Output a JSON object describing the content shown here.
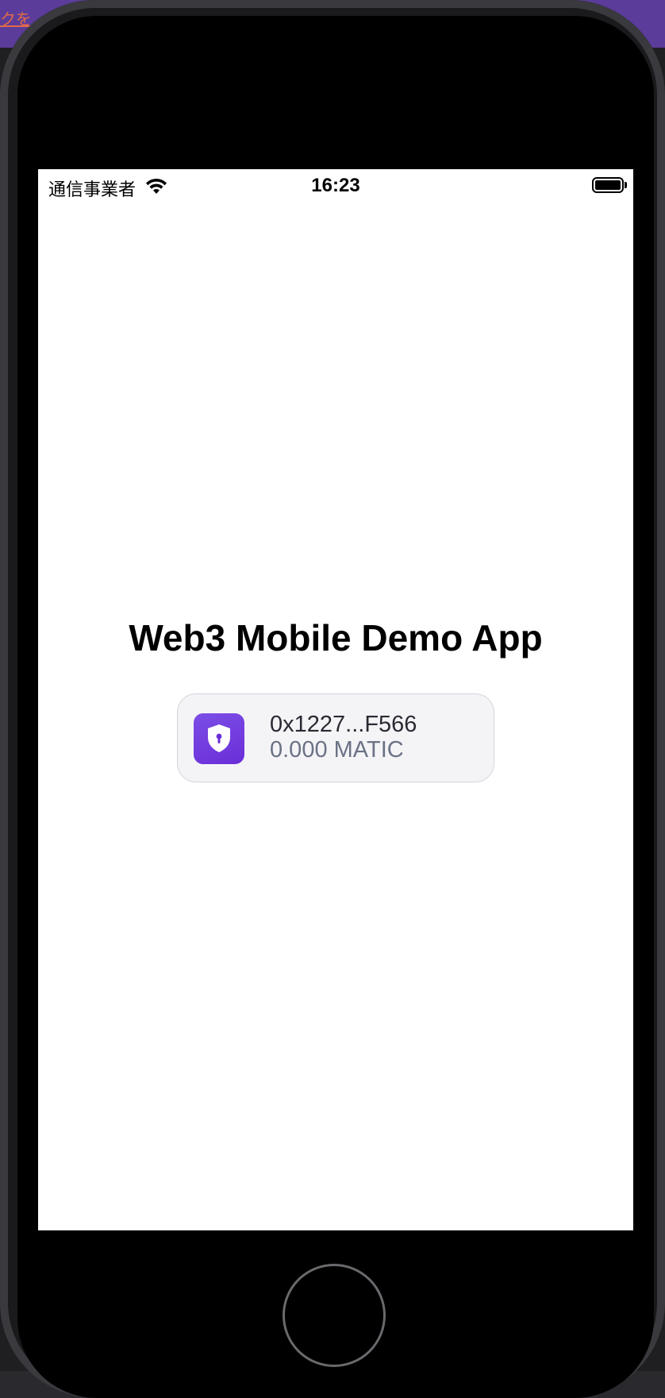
{
  "backdrop": {
    "link_text": "クを"
  },
  "status_bar": {
    "carrier": "通信事業者",
    "time": "16:23",
    "wifi_icon": "wifi-icon",
    "battery_icon": "battery-icon"
  },
  "main": {
    "title": "Web3 Mobile Demo App",
    "account_button": {
      "icon": "shield-lock-icon",
      "address": "0x1227...F566",
      "balance": "0.000 MATIC"
    }
  },
  "colors": {
    "accent": "#6a2ed8",
    "card_background": "#f4f4f7",
    "balance_text": "#6b7285"
  }
}
